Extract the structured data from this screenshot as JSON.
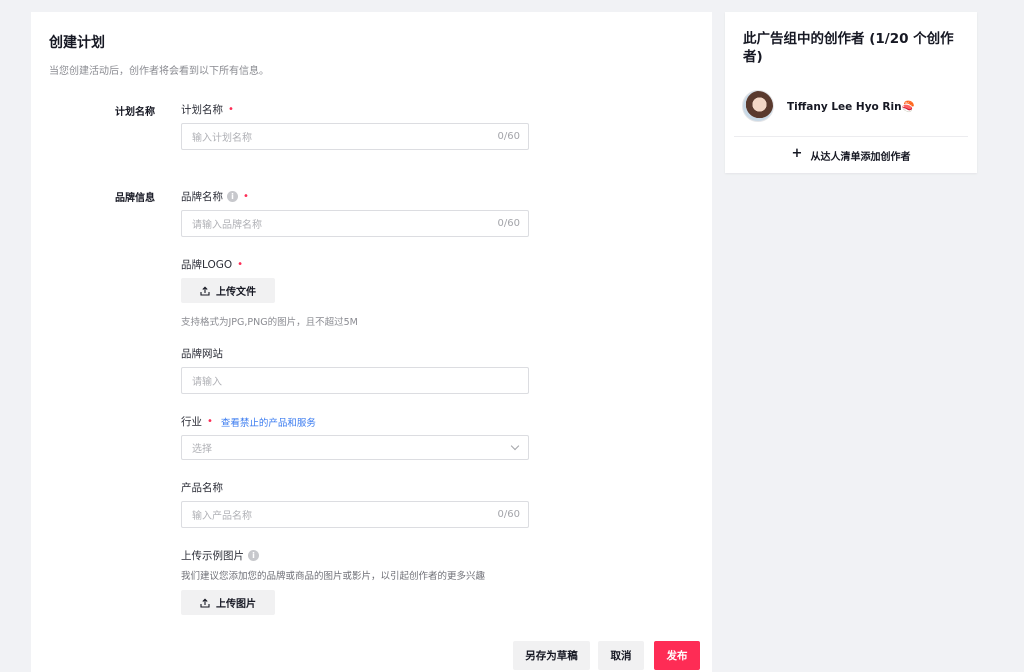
{
  "form": {
    "title": "创建计划",
    "subtitle": "当您创建活动后，创作者将会看到以下所有信息。",
    "required_mark": "•",
    "sections": {
      "plan": "计划名称",
      "brand": "品牌信息"
    },
    "plan_name": {
      "label": "计划名称",
      "placeholder": "输入计划名称",
      "counter": "0/60"
    },
    "brand_name": {
      "label": "品牌名称",
      "placeholder": "请输入品牌名称",
      "counter": "0/60"
    },
    "brand_logo": {
      "label": "品牌LOGO",
      "upload_label": "上传文件",
      "hint": "支持格式为JPG,PNG的图片，且不超过5M"
    },
    "brand_website": {
      "label": "品牌网站",
      "placeholder": "请输入"
    },
    "industry": {
      "label": "行业",
      "link": "查看禁止的产品和服务",
      "placeholder": "选择"
    },
    "product_name": {
      "label": "产品名称",
      "placeholder": "输入产品名称",
      "counter": "0/60"
    },
    "sample_images": {
      "label": "上传示例图片",
      "hint": "我们建议您添加您的品牌或商品的图片或影片，以引起创作者的更多兴趣",
      "upload_label": "上传图片"
    }
  },
  "footer": {
    "save_draft": "另存为草稿",
    "cancel": "取消",
    "publish": "发布"
  },
  "sidebar": {
    "title": "此广告组中的创作者 (1/20 个创作者)",
    "creator_name": "Tiffany Lee Hyo Rin🍣",
    "add_creator": "从达人清单添加创作者",
    "plus": "+"
  },
  "colors": {
    "accent": "#fe2c55",
    "link": "#3a7bf0"
  },
  "icons": [
    "upload-icon",
    "info-icon",
    "chevron-down-icon",
    "plus-icon"
  ]
}
